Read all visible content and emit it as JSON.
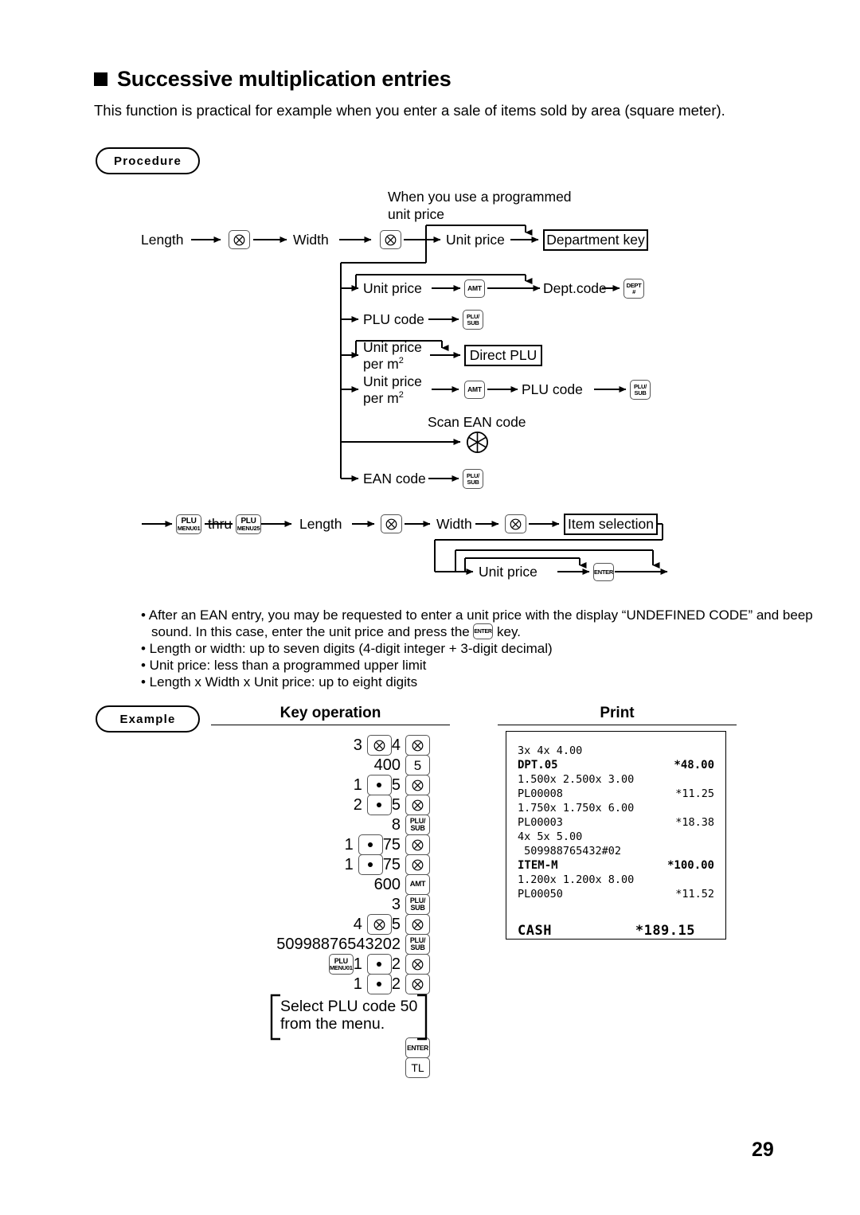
{
  "page": {
    "number": "29",
    "heading": "Successive multiplication entries",
    "intro": "This function is practical for example when you enter a sale of items sold by area (square meter).",
    "procedure_label": "Procedure",
    "example_label": "Example"
  },
  "procedure": {
    "note_programmed_line1": "When you use a programmed",
    "note_programmed_line2": "unit price",
    "length": "Length",
    "width": "Width",
    "unit_price": "Unit price",
    "department_key": "Department key",
    "dept_code": "Dept.code",
    "plu_code": "PLU code",
    "unit_price_per_m2_line1": "Unit price",
    "unit_price_per_m2_line2": "per m",
    "per_m2_sup": "2",
    "direct_plu": "Direct PLU",
    "scan_ean_code": "Scan EAN code",
    "ean_code": "EAN code",
    "thru": "thru",
    "item_selection": "Item selection",
    "keys": {
      "multiply": "⊗",
      "amt_l1": "AMT",
      "plu_l1": "PLU/",
      "plu_l2": "SUB",
      "dept_l1": "DEPT",
      "dept_l2": "#",
      "plumenu_l1": "PLU",
      "plumenu01_l2": "MENU01",
      "plumenu25_l2": "MENU25",
      "enter": "ENTER"
    }
  },
  "notes": [
    "• After an EAN entry, you may be requested to enter a unit price with the display “UNDEFINED CODE” and beep",
    "sound.  In this case, enter the unit price and press the",
    "key.",
    "• Length or width: up to seven digits (4-digit integer + 3-digit decimal)",
    "• Unit price: less than a programmed upper limit",
    "• Length x Width x Unit price: up to eight digits"
  ],
  "example": {
    "key_operation_header": "Key operation",
    "print_header": "Print",
    "bracket_note_line1": "Select PLU code 50",
    "bracket_note_line2": "from the menu.",
    "rows": [
      {
        "items": [
          {
            "t": "num",
            "v": "3"
          },
          {
            "t": "key",
            "v": "multiply"
          },
          {
            "t": "num",
            "v": "4"
          },
          {
            "t": "key",
            "v": "multiply"
          }
        ]
      },
      {
        "items": [
          {
            "t": "num",
            "v": "400"
          },
          {
            "t": "key",
            "v": "5"
          }
        ]
      },
      {
        "items": [
          {
            "t": "num",
            "v": "1"
          },
          {
            "t": "key",
            "v": "dot"
          },
          {
            "t": "num",
            "v": "5"
          },
          {
            "t": "key",
            "v": "multiply"
          }
        ]
      },
      {
        "items": [
          {
            "t": "num",
            "v": "2"
          },
          {
            "t": "key",
            "v": "dot"
          },
          {
            "t": "num",
            "v": "5"
          },
          {
            "t": "key",
            "v": "multiply"
          }
        ]
      },
      {
        "items": [
          {
            "t": "num",
            "v": "8"
          },
          {
            "t": "key",
            "v": "plusub"
          }
        ]
      },
      {
        "items": [
          {
            "t": "num",
            "v": "1"
          },
          {
            "t": "key",
            "v": "dot"
          },
          {
            "t": "num",
            "v": "75"
          },
          {
            "t": "key",
            "v": "multiply"
          }
        ]
      },
      {
        "items": [
          {
            "t": "num",
            "v": "1"
          },
          {
            "t": "key",
            "v": "dot"
          },
          {
            "t": "num",
            "v": "75"
          },
          {
            "t": "key",
            "v": "multiply"
          }
        ]
      },
      {
        "items": [
          {
            "t": "num",
            "v": "600"
          },
          {
            "t": "key",
            "v": "amt"
          }
        ]
      },
      {
        "items": [
          {
            "t": "num",
            "v": "3"
          },
          {
            "t": "key",
            "v": "plusub"
          }
        ]
      },
      {
        "items": [
          {
            "t": "num",
            "v": "4"
          },
          {
            "t": "key",
            "v": "multiply"
          },
          {
            "t": "num",
            "v": "5"
          },
          {
            "t": "key",
            "v": "multiply"
          }
        ]
      },
      {
        "items": [
          {
            "t": "num",
            "v": "50998876543202"
          },
          {
            "t": "key",
            "v": "plusub"
          }
        ]
      },
      {
        "items": [
          {
            "t": "key",
            "v": "plumenu01"
          },
          {
            "t": "num",
            "v": "1"
          },
          {
            "t": "key",
            "v": "dot"
          },
          {
            "t": "num",
            "v": "2"
          },
          {
            "t": "key",
            "v": "multiply"
          }
        ]
      },
      {
        "items": [
          {
            "t": "num",
            "v": "1"
          },
          {
            "t": "key",
            "v": "dot"
          },
          {
            "t": "num",
            "v": "2"
          },
          {
            "t": "key",
            "v": "multiply"
          }
        ]
      },
      {
        "items": [
          {
            "t": "key",
            "v": "enter"
          }
        ]
      },
      {
        "items": [
          {
            "t": "key",
            "v": "tl"
          }
        ]
      }
    ]
  },
  "receipt": {
    "lines": [
      {
        "left": "3x 4x 4.00",
        "right": "",
        "style": "normal"
      },
      {
        "left": "DPT.05",
        "right": "*48.00",
        "style": "bold-dpt"
      },
      {
        "left": "1.500x 2.500x 3.00",
        "right": "",
        "style": "normal"
      },
      {
        "left": "PL00008",
        "right": "*11.25",
        "style": "normal"
      },
      {
        "left": "1.750x 1.750x 6.00",
        "right": "",
        "style": "normal"
      },
      {
        "left": "PL00003",
        "right": "*18.38",
        "style": "normal"
      },
      {
        "left": "4x 5x 5.00",
        "right": "",
        "style": "normal"
      },
      {
        "left": " 509988765432#02",
        "right": "",
        "style": "normal"
      },
      {
        "left": "ITEM-M",
        "right": "*100.00",
        "style": "bold"
      },
      {
        "left": "1.200x 1.200x 8.00",
        "right": "",
        "style": "normal"
      },
      {
        "left": "PL00050",
        "right": "*11.52",
        "style": "normal"
      },
      {
        "left": "",
        "right": "",
        "style": "normal"
      },
      {
        "left": "CASH",
        "right": "*189.15",
        "style": "total"
      }
    ]
  }
}
